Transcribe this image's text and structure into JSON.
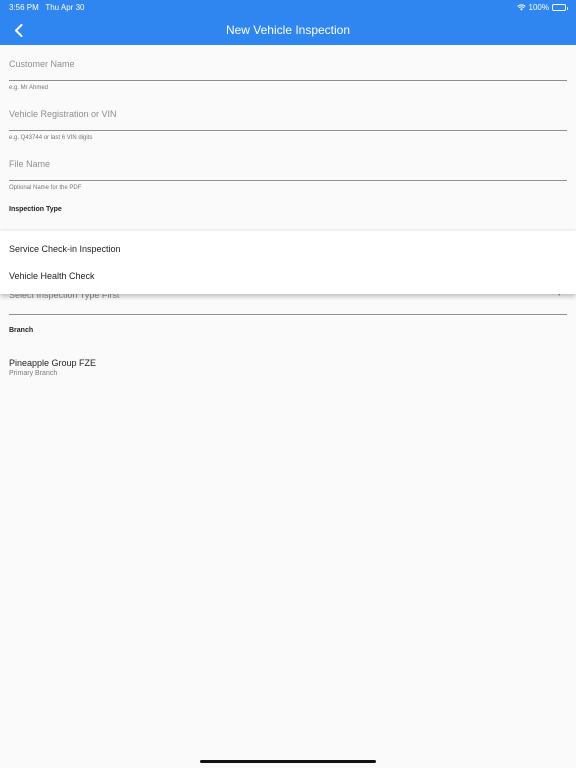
{
  "status": {
    "time": "3:56 PM",
    "date": "Thu Apr 30",
    "battery": "100%"
  },
  "header": {
    "title": "New Vehicle Inspection"
  },
  "fields": {
    "customer": {
      "value": "Customer Name",
      "hint": "e.g. Mr Ahmed"
    },
    "vehicle": {
      "value": "Vehicle Registration or VIN",
      "hint": "e.g. Q43744 or last 6 VIN digits"
    },
    "file": {
      "value": "File Name",
      "hint": "Optional Name for the PDF"
    }
  },
  "inspection": {
    "label": "Inspection Type",
    "options": [
      "Service Check-in Inspection",
      "Vehicle Health Check"
    ],
    "select_placeholder": "Select Inspection Type First"
  },
  "branch": {
    "label": "Branch",
    "name": "Pineapple Group FZE",
    "subtitle": "Primary Branch"
  },
  "icons": {
    "back": "chevron-left-icon",
    "wifi": "wifi-icon",
    "battery": "battery-icon",
    "dropdown": "chevron-down-icon"
  },
  "colors": {
    "accent": "#2f86f0"
  }
}
